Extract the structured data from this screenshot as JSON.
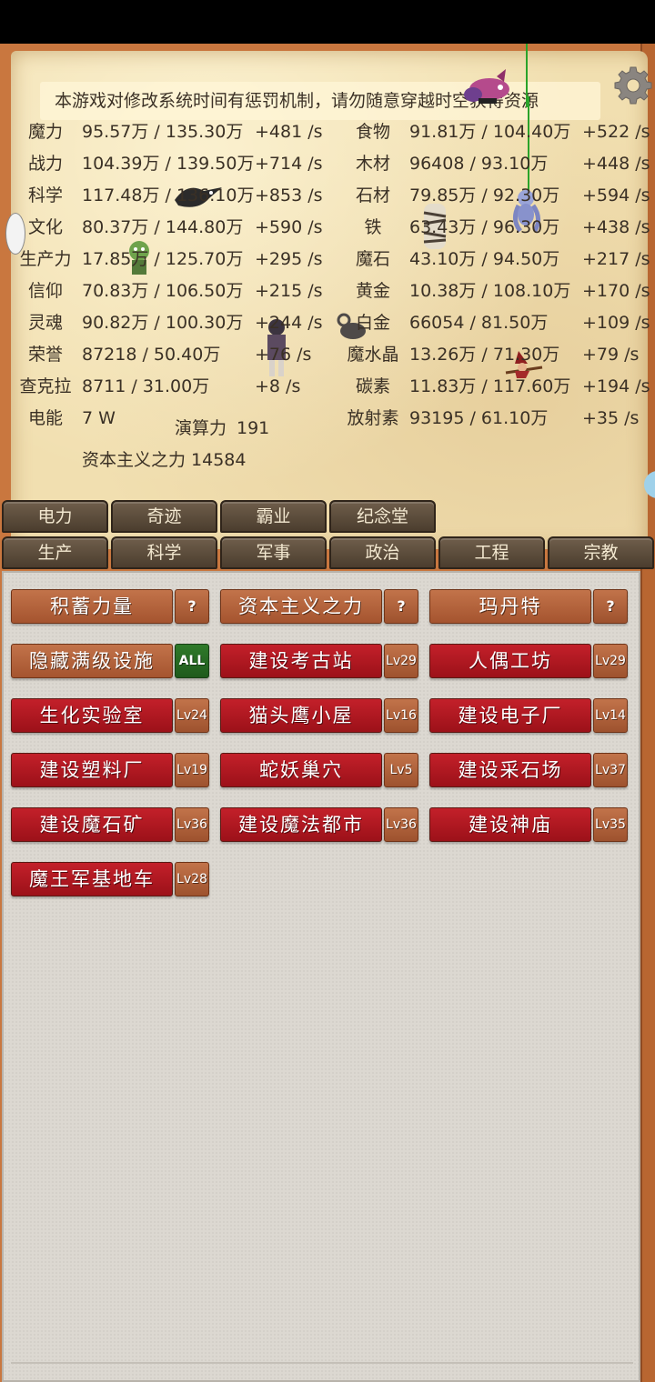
{
  "notice": "本游戏对修改系统时间有惩罚机制，请勿随意穿越时空获得资源",
  "stats_left": [
    {
      "name": "魔力",
      "amount": "95.57万 / 135.30万",
      "rate": "+481 /s"
    },
    {
      "name": "战力",
      "amount": "104.39万 / 139.50万",
      "rate": "+714 /s"
    },
    {
      "name": "科学",
      "amount": "117.48万 / 136.10万",
      "rate": "+853 /s"
    },
    {
      "name": "文化",
      "amount": "80.37万 / 144.80万",
      "rate": "+590 /s"
    },
    {
      "name": "生产力",
      "amount": "17.85万 / 125.70万",
      "rate": "+295 /s"
    },
    {
      "name": "信仰",
      "amount": "70.83万 / 106.50万",
      "rate": "+215 /s"
    },
    {
      "name": "灵魂",
      "amount": "90.82万 / 100.30万",
      "rate": "+244 /s"
    },
    {
      "name": "荣誉",
      "amount": "87218 / 50.40万",
      "rate": "+76 /s"
    },
    {
      "name": "查克拉",
      "amount": "8711 / 31.00万",
      "rate": "+8 /s"
    },
    {
      "name": "电能",
      "amount": "7 W",
      "rate": ""
    }
  ],
  "stats_right": [
    {
      "name": "食物",
      "amount": "91.81万 / 104.40万",
      "rate": "+522 /s"
    },
    {
      "name": "木材",
      "amount": "96408 / 93.10万",
      "rate": "+448 /s"
    },
    {
      "name": "石材",
      "amount": "79.85万 / 92.30万",
      "rate": "+594 /s"
    },
    {
      "name": "铁",
      "amount": "63.43万 / 96.30万",
      "rate": "+438 /s"
    },
    {
      "name": "魔石",
      "amount": "43.10万 / 94.50万",
      "rate": "+217 /s"
    },
    {
      "name": "黄金",
      "amount": "10.38万 / 108.10万",
      "rate": "+170 /s"
    },
    {
      "name": "白金",
      "amount": "66054 / 81.50万",
      "rate": "+109 /s"
    },
    {
      "name": "魔水晶",
      "amount": "13.26万 / 71.30万",
      "rate": "+79 /s"
    },
    {
      "name": "碳素",
      "amount": "11.83万 / 117.60万",
      "rate": "+194 /s"
    },
    {
      "name": "放射素",
      "amount": "93195 / 61.10万",
      "rate": "+35 /s"
    }
  ],
  "compute": {
    "label": "演算力",
    "value": "191"
  },
  "capitalism": "资本主义之力 14584",
  "tabs_row1": [
    "电力",
    "奇迹",
    "霸业",
    "纪念堂"
  ],
  "tabs_row2": [
    "生产",
    "科学",
    "军事",
    "政治",
    "工程",
    "宗教"
  ],
  "buttons": [
    {
      "label": "积蓄力量",
      "badge": "?",
      "style": "brown",
      "badge_style": "q"
    },
    {
      "label": "资本主义之力",
      "badge": "?",
      "style": "brown",
      "badge_style": "q"
    },
    {
      "label": "玛丹特",
      "badge": "?",
      "style": "brown",
      "badge_style": "q"
    },
    {
      "label": "隐藏满级设施",
      "badge": "ALL",
      "style": "brown",
      "badge_style": "green"
    },
    {
      "label": "建设考古站",
      "badge": "Lv29",
      "style": "red",
      "badge_style": "lv"
    },
    {
      "label": "人偶工坊",
      "badge": "Lv29",
      "style": "red",
      "badge_style": "lv"
    },
    {
      "label": "生化实验室",
      "badge": "Lv24",
      "style": "red",
      "badge_style": "lv"
    },
    {
      "label": "猫头鹰小屋",
      "badge": "Lv16",
      "style": "red",
      "badge_style": "lv"
    },
    {
      "label": "建设电子厂",
      "badge": "Lv14",
      "style": "red",
      "badge_style": "lv"
    },
    {
      "label": "建设塑料厂",
      "badge": "Lv19",
      "style": "red",
      "badge_style": "lv"
    },
    {
      "label": "蛇妖巢穴",
      "badge": "Lv5",
      "style": "red",
      "badge_style": "lv"
    },
    {
      "label": "建设采石场",
      "badge": "Lv37",
      "style": "red",
      "badge_style": "lv"
    },
    {
      "label": "建设魔石矿",
      "badge": "Lv36",
      "style": "red",
      "badge_style": "lv"
    },
    {
      "label": "建设魔法都市",
      "badge": "Lv36",
      "style": "red",
      "badge_style": "lv"
    },
    {
      "label": "建设神庙",
      "badge": "Lv35",
      "style": "red",
      "badge_style": "lv"
    },
    {
      "label": "魔王军基地车",
      "badge": "Lv28",
      "style": "red",
      "badge_style": "lv"
    }
  ],
  "colors": {
    "frame": "#c9773f",
    "parchment": "#f1dfb0",
    "tab": "#5a4a3a",
    "button_red": "#b51922",
    "button_brown": "#b5623b",
    "badge_green": "#2a6e25",
    "panel": "#dcd8d1"
  }
}
